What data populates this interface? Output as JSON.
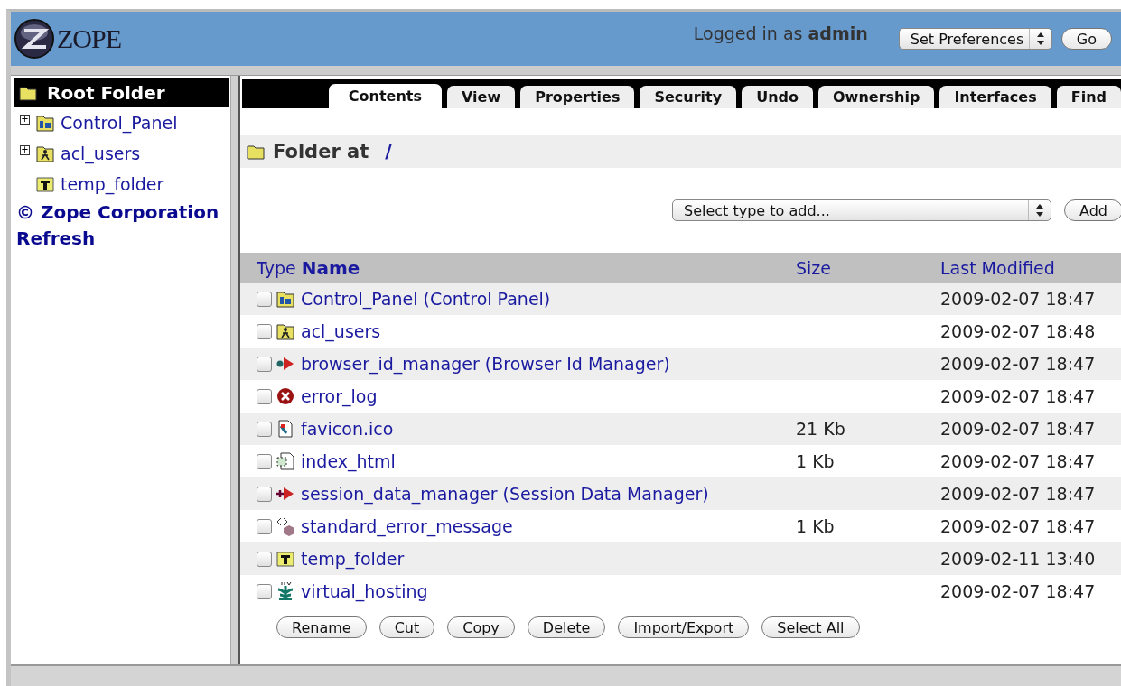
{
  "header": {
    "logo_text": "ZOPE",
    "login_prefix": "Logged in as",
    "login_user": "admin",
    "preferences_select": "Set Preferences",
    "go_button": "Go"
  },
  "sidebar": {
    "root": "Root Folder",
    "items": [
      {
        "label": "Control_Panel",
        "kind": "control_panel",
        "toggle": "+"
      },
      {
        "label": "acl_users",
        "kind": "users",
        "toggle": "+"
      },
      {
        "label": "temp_folder",
        "kind": "temp_folder"
      }
    ],
    "links": [
      "© Zope Corporation",
      "Refresh"
    ]
  },
  "tabs": [
    {
      "label": "Contents",
      "selected": true
    },
    {
      "label": "View",
      "selected": false
    },
    {
      "label": "Properties",
      "selected": false
    },
    {
      "label": "Security",
      "selected": false
    },
    {
      "label": "Undo",
      "selected": false
    },
    {
      "label": "Ownership",
      "selected": false
    },
    {
      "label": "Interfaces",
      "selected": false
    },
    {
      "label": "Find",
      "selected": false
    }
  ],
  "location": {
    "label": "Folder at",
    "path": "/"
  },
  "add": {
    "select": "Select type to add...",
    "button": "Add"
  },
  "table": {
    "columns": [
      "Type",
      "Name",
      "Size",
      "Last Modified"
    ],
    "rows": [
      {
        "name": "Control_Panel (Control Panel)",
        "kind": "control_panel",
        "size": "",
        "modified": "2009-02-07 18:47",
        "checked": false
      },
      {
        "name": "acl_users",
        "kind": "users",
        "size": "",
        "modified": "2009-02-07 18:48",
        "checked": false
      },
      {
        "name": "browser_id_manager (Browser Id Manager)",
        "kind": "id_manager",
        "size": "",
        "modified": "2009-02-07 18:47",
        "checked": false
      },
      {
        "name": "error_log",
        "kind": "error",
        "size": "",
        "modified": "2009-02-07 18:47",
        "checked": false
      },
      {
        "name": "favicon.ico",
        "kind": "image",
        "size": "21 Kb",
        "modified": "2009-02-07 18:47",
        "checked": false
      },
      {
        "name": "index_html",
        "kind": "html",
        "size": "1 Kb",
        "modified": "2009-02-07 18:47",
        "checked": false
      },
      {
        "name": "session_data_manager (Session Data Manager)",
        "kind": "session",
        "size": "",
        "modified": "2009-02-07 18:47",
        "checked": false
      },
      {
        "name": "standard_error_message",
        "kind": "message",
        "size": "1 Kb",
        "modified": "2009-02-07 18:47",
        "checked": false
      },
      {
        "name": "temp_folder",
        "kind": "temp_folder",
        "size": "",
        "modified": "2009-02-11 13:40",
        "checked": false
      },
      {
        "name": "virtual_hosting",
        "kind": "vhost",
        "size": "",
        "modified": "2009-02-07 18:47",
        "checked": false
      }
    ]
  },
  "actions": [
    "Rename",
    "Cut",
    "Copy",
    "Delete",
    "Import/Export",
    "Select All"
  ]
}
